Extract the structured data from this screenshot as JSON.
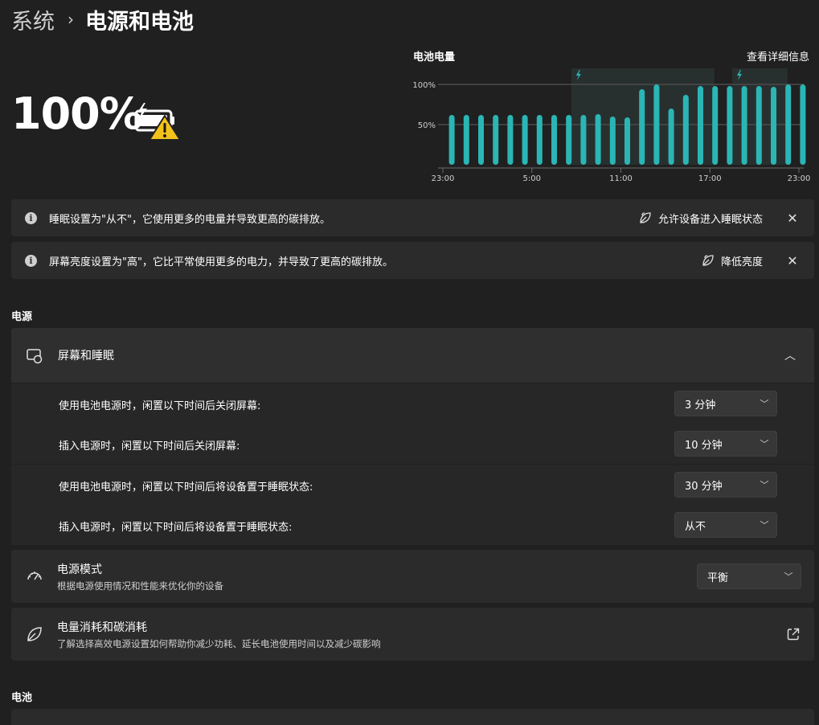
{
  "breadcrumb": {
    "parent": "系统",
    "separator": "›",
    "current": "电源和电池"
  },
  "battery": {
    "percent_text": "100%",
    "icon": "battery-charging-warning-icon"
  },
  "chart": {
    "title": "电池电量",
    "link": "查看详细信息",
    "y_ticks": [
      "100%",
      "50%"
    ],
    "x_ticks": [
      "23:00",
      "5:00",
      "11:00",
      "17:00",
      "23:00"
    ],
    "accent_color": "#2bb5b5",
    "charging_icon": "lightning-bolt-icon"
  },
  "chart_data": {
    "type": "bar",
    "title": "电池电量",
    "xlabel": "",
    "ylabel": "",
    "ylim": [
      0,
      100
    ],
    "x_tick_labels": [
      "23:00",
      "5:00",
      "11:00",
      "17:00",
      "23:00"
    ],
    "y_tick_labels": [
      "50%",
      "100%"
    ],
    "values": [
      62,
      62,
      62,
      62,
      62,
      62,
      62,
      62,
      62,
      62,
      63,
      60,
      59,
      94,
      100,
      70,
      87,
      98,
      98,
      98,
      98,
      98,
      97,
      100,
      100
    ],
    "charging_periods": [
      {
        "start_index": 9,
        "end_index": 18
      },
      {
        "start_index": 20,
        "end_index": 23
      }
    ],
    "grid": true
  },
  "notices": [
    {
      "text": "睡眠设置为\"从不\"，它使用更多的电量并导致更高的碳排放。",
      "action": "允许设备进入睡眠状态",
      "close": "✕"
    },
    {
      "text": "屏幕亮度设置为\"高\"，它比平常使用更多的电力，并导致了更高的碳排放。",
      "action": "降低亮度",
      "close": "✕"
    }
  ],
  "sections": {
    "power": "电源",
    "battery": "电池"
  },
  "screen_sleep": {
    "title": "屏幕和睡眠",
    "rows": [
      {
        "label": "使用电池电源时，闲置以下时间后关闭屏幕:",
        "value": "3 分钟"
      },
      {
        "label": "插入电源时，闲置以下时间后关闭屏幕:",
        "value": "10 分钟"
      },
      {
        "label": "使用电池电源时，闲置以下时间后将设备置于睡眠状态:",
        "value": "30 分钟"
      },
      {
        "label": "插入电源时，闲置以下时间后将设备置于睡眠状态:",
        "value": "从不"
      }
    ]
  },
  "power_mode": {
    "title": "电源模式",
    "subtitle": "根据电源使用情况和性能来优化你的设备",
    "value": "平衡"
  },
  "energy": {
    "title": "电量消耗和碳消耗",
    "subtitle": "了解选择高效电源设置如何帮助你减少功耗、延长电池使用时间以及减少碳影响"
  }
}
